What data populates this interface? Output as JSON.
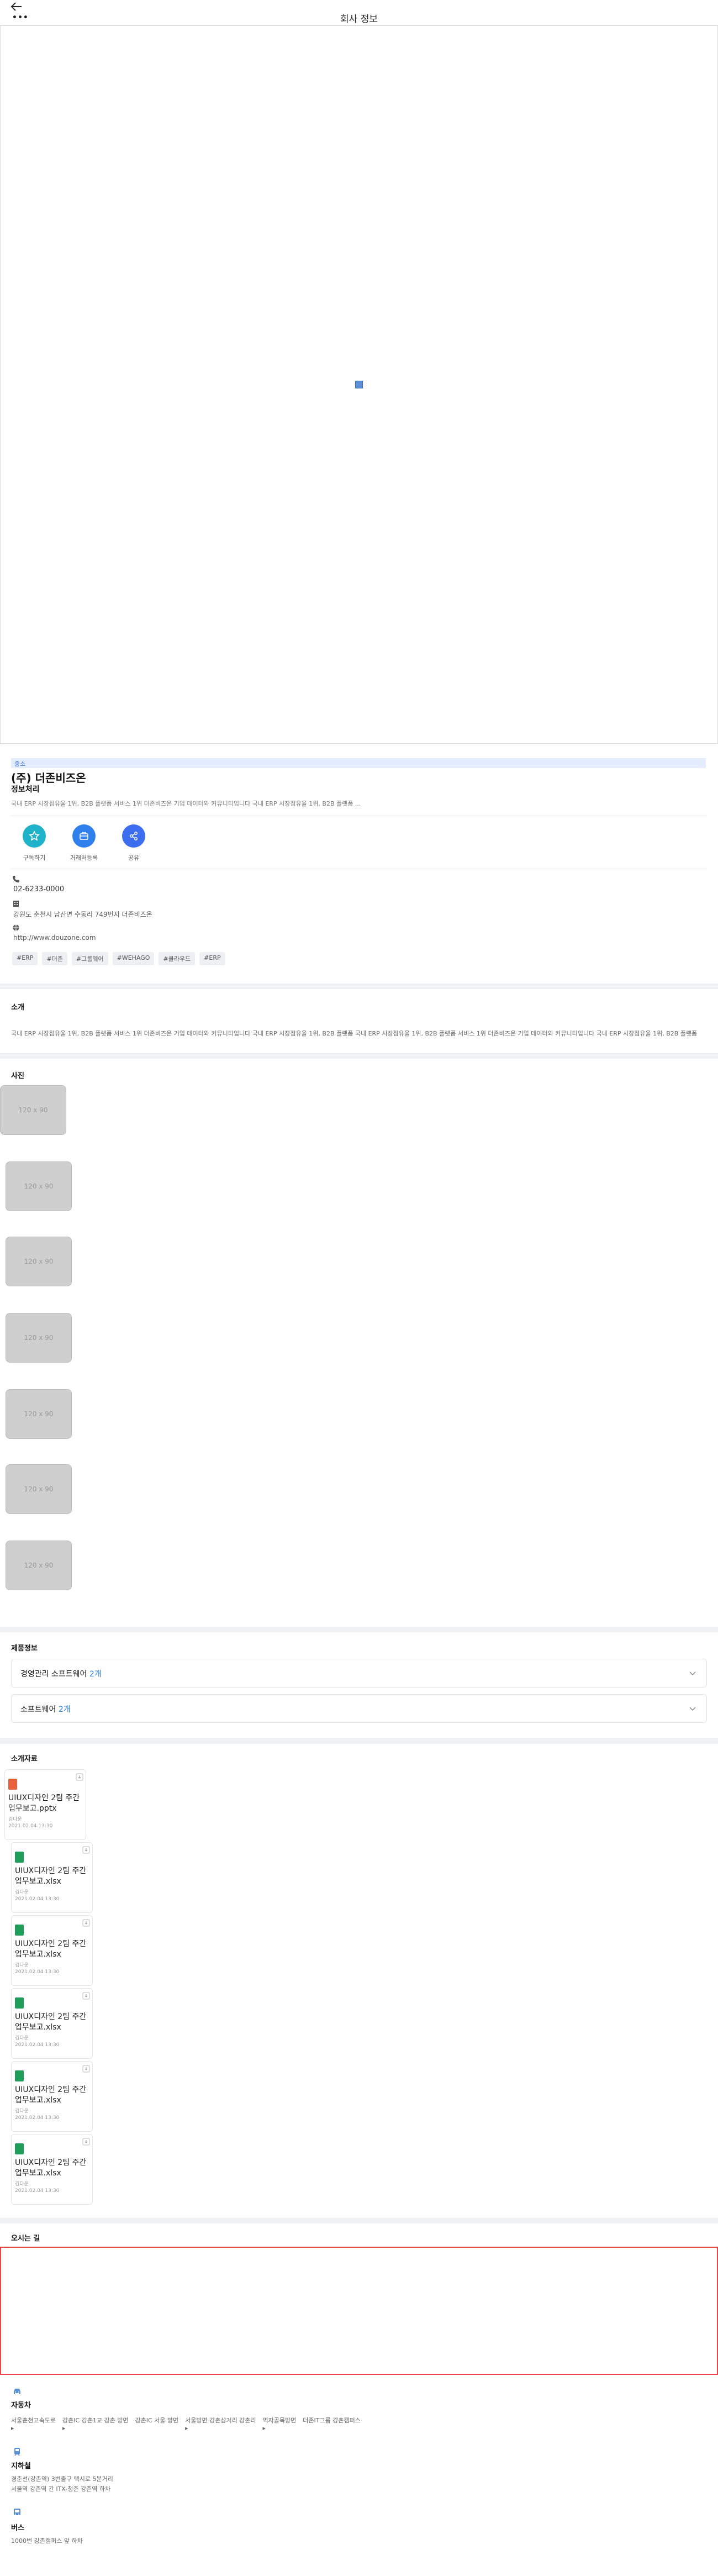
{
  "header": {
    "title": "회사 정보",
    "back": "back-arrow-icon",
    "more": "•••"
  },
  "company": {
    "tag": "중소",
    "name": "(주) 더존비즈온",
    "sub": "정보처리",
    "description": "국내 ERP 시장점유율 1위, B2B 플랫폼 서비스 1위 더존비즈온 기업 데이터와 커뮤니티입니다 국내 ERP 시장점유율 1위, B2B 플랫폼 ...",
    "actions": [
      {
        "label": "구독하기",
        "icon": "star-icon",
        "color": "#20b2c8"
      },
      {
        "label": "거래처등록",
        "icon": "briefcase-icon",
        "color": "#2f80ed"
      },
      {
        "label": "공유",
        "icon": "share-icon",
        "color": "#3d6ef0"
      }
    ],
    "phone": "02-6233-0000",
    "address": "강원도 춘천시 남산면 수동리 749번지 더존비즈온",
    "website": "http://www.douzone.com",
    "hashtags": [
      "#ERP",
      "#더존",
      "#그룹웨어",
      "#WEHAGO",
      "#클라우드",
      "#ERP"
    ]
  },
  "intro": {
    "title": "소개",
    "text": "국내 ERP 시장점유율 1위, B2B 플랫폼 서비스 1위 더존비즈온 기업 데이터와 커뮤니티입니다 국내 ERP 시장점유율 1위, B2B 플랫폼 국내 ERP 시장점유율 1위, B2B 플랫폼 서비스 1위 더존비즈온 기업 데이터와 커뮤니티입니다 국내 ERP 시장점유율 1위, B2B 플랫폼"
  },
  "photos": {
    "title": "사진",
    "placeholder": "120 x 90"
  },
  "products": {
    "title": "제품정보",
    "items": [
      {
        "label": "경영관리 소프트웨어",
        "count": "2개"
      },
      {
        "label": "소프트웨어",
        "count": "2개"
      }
    ]
  },
  "materials": {
    "title": "소개자료",
    "files": [
      {
        "name": "UIUX디자인 2팀 주간 업무보고.pptx",
        "type": "pptx",
        "author": "김다운",
        "date": "2021.02.04 13:30",
        "color": "#e8603c"
      },
      {
        "name": "UIUX디자인 2팀 주간 업무보고.xlsx",
        "type": "xlsx",
        "author": "김다운",
        "date": "2021.02.04 13:30",
        "color": "#1e9e5a"
      },
      {
        "name": "UIUX디자인 2팀 주간 업무보고.xlsx",
        "type": "xlsx",
        "author": "김다운",
        "date": "2021.02.04 13:30",
        "color": "#1e9e5a"
      },
      {
        "name": "UIUX디자인 2팀 주간 업무보고.xlsx",
        "type": "xlsx",
        "author": "김다운",
        "date": "2021.02.04 13:30",
        "color": "#1e9e5a"
      },
      {
        "name": "UIUX디자인 2팀 주간 업무보고.xlsx",
        "type": "xlsx",
        "author": "김다운",
        "date": "2021.02.04 13:30",
        "color": "#1e9e5a"
      },
      {
        "name": "UIUX디자인 2팀 주간 업무보고.xlsx",
        "type": "xlsx",
        "author": "김다운",
        "date": "2021.02.04 13:30",
        "color": "#1e9e5a"
      }
    ]
  },
  "directions": {
    "title": "오시는 길",
    "car": {
      "title": "자동차",
      "steps": [
        "서울춘천고속도로",
        "강촌IC 강촌1교 강촌 방면",
        "강촌IC 서울 방면",
        "서울방면 강촌삼거리 강촌리",
        "먹자골목방면",
        "더존IT그룹 강촌캠퍼스"
      ]
    },
    "subway": {
      "title": "지하철",
      "lines": [
        "경춘선(강촌역) 3번출구 택시로 5분거리",
        "서울역 강촌역 간 ITX-청춘 강촌역 하차"
      ]
    },
    "bus": {
      "title": "버스",
      "lines": [
        "1000번 강촌캠퍼스 앞 하차"
      ]
    }
  }
}
